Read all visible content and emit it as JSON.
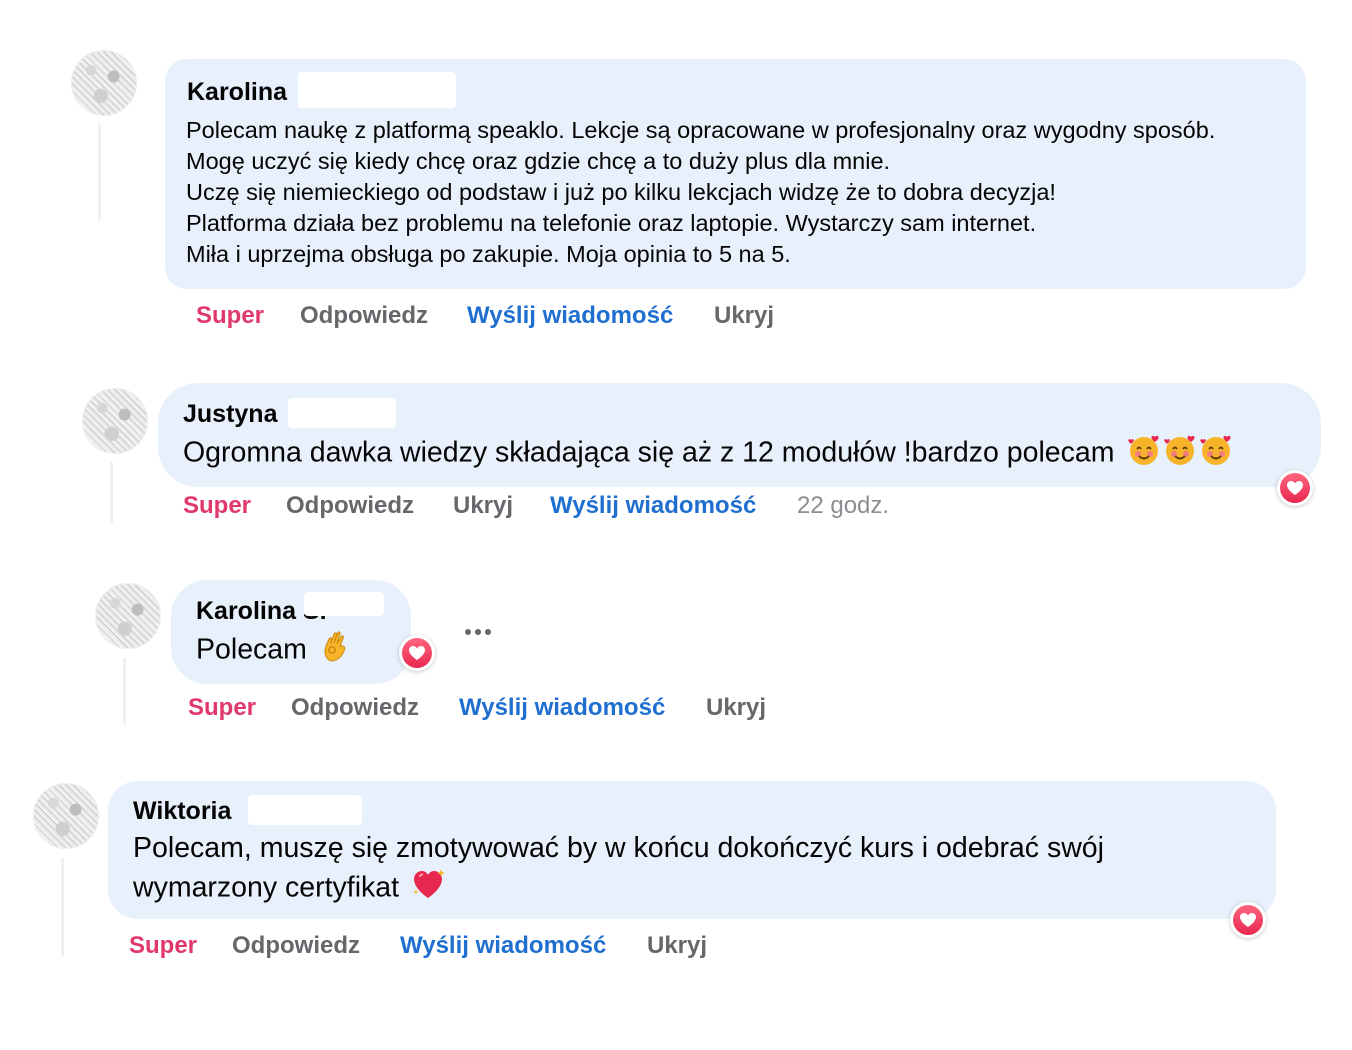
{
  "comments": [
    {
      "name": "Karolina",
      "lines": [
        "Polecam naukę z platformą speaklo. Lekcje są opracowane w profesjonalny oraz wygodny sposób.",
        "Mogę uczyć się kiedy chcę oraz gdzie chcę a to duży plus dla mnie.",
        "Uczę się niemieckiego od podstaw i już po kilku lekcjach widzę że to dobra decyzja!",
        "Platforma działa bez problemu na telefonie oraz laptopie. Wystarczy sam internet.",
        "Miła i uprzejma obsługa po zakupie. Moja opinia to 5 na 5."
      ],
      "actions": [
        "Super",
        "Odpowiedz",
        "Wyślij wiadomość",
        "Ukryj"
      ]
    },
    {
      "name": "Justyna",
      "text": "Ogromna dawka wiedzy składająca się aż z 12 modułów !bardzo polecam",
      "emoji_icons": [
        "smiling-face-with-hearts-icon",
        "smiling-face-with-hearts-icon",
        "smiling-face-with-hearts-icon"
      ],
      "reaction_icon": "heart-icon",
      "actions": [
        "Super",
        "Odpowiedz",
        "Ukryj",
        "Wyślij wiadomość"
      ],
      "time": "22 godz."
    },
    {
      "name": "Karolina S.",
      "text": "Polecam",
      "emoji_icon": "ok-hand-icon",
      "reaction_icon": "heart-icon",
      "more_icon": "more-options-icon",
      "actions": [
        "Super",
        "Odpowiedz",
        "Wyślij wiadomość",
        "Ukryj"
      ]
    },
    {
      "name": "Wiktoria",
      "lines": [
        "Polecam, muszę się zmotywować by w końcu dokończyć kurs i odebrać swój",
        "wymarzony certyfikat"
      ],
      "emoji_icon": "heart-with-sparkles-icon",
      "reaction_icon": "heart-icon",
      "actions": [
        "Super",
        "Odpowiedz",
        "Wyślij wiadomość",
        "Ukryj"
      ]
    }
  ],
  "colors": {
    "bubble": "#e7f0fb",
    "super": "#e0386b",
    "link": "#1f6fd0",
    "muted": "#65676b",
    "heart": "#e8274f"
  }
}
